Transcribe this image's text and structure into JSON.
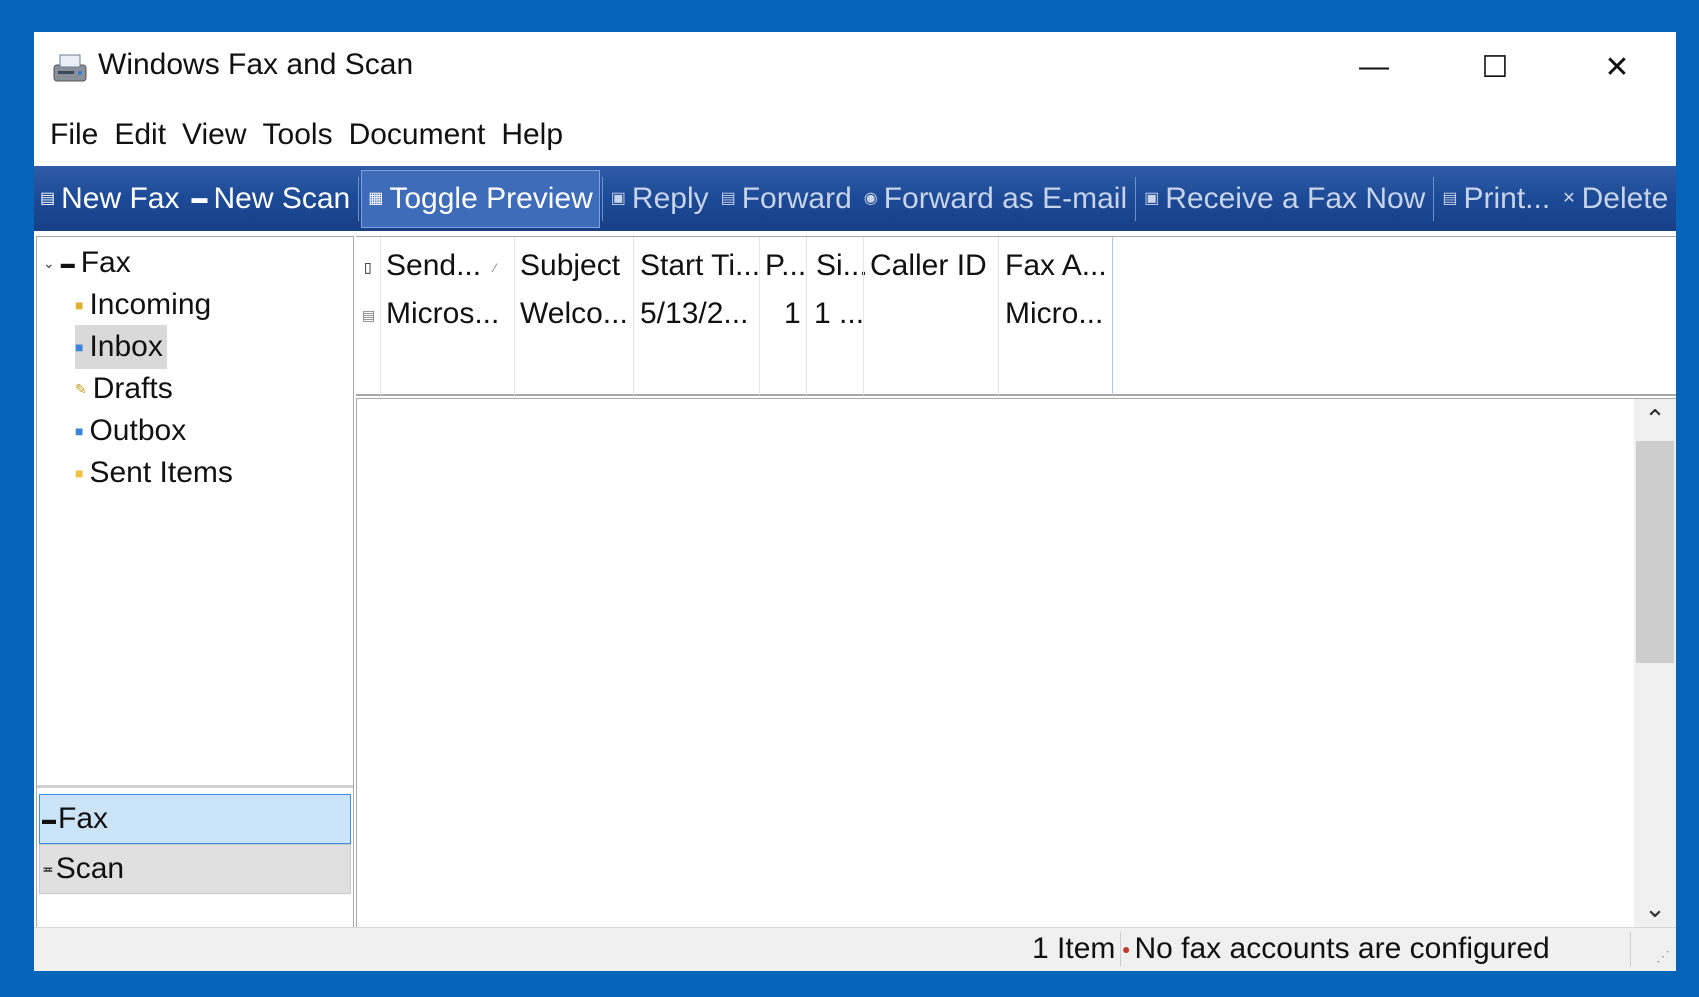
{
  "window": {
    "title": "Windows Fax and Scan",
    "controls": {
      "minimize": "—",
      "maximize": "☐",
      "close": "✕"
    }
  },
  "menu": [
    "File",
    "Edit",
    "View",
    "Tools",
    "Document",
    "Help"
  ],
  "toolbar": {
    "new_fax": "New Fax",
    "new_scan": "New Scan",
    "toggle_preview": "Toggle Preview",
    "reply": "Reply",
    "forward": "Forward",
    "forward_email": "Forward as E-mail",
    "receive_fax": "Receive a Fax Now",
    "print": "Print...",
    "delete": "Delete"
  },
  "tree": {
    "root": "Fax",
    "folders": [
      "Incoming",
      "Inbox",
      "Drafts",
      "Outbox",
      "Sent Items"
    ],
    "selected": "Inbox"
  },
  "nav": {
    "fax": "Fax",
    "scan": "Scan",
    "active": "Fax"
  },
  "list": {
    "columns": [
      "Send...",
      "Subject",
      "Start Ti...",
      "P...",
      "Si...",
      "Caller ID",
      "Fax A..."
    ],
    "rows": [
      [
        "Micros...",
        "Welco...",
        "5/13/2...",
        "1",
        "1 ...",
        "",
        "Micro..."
      ]
    ]
  },
  "status": {
    "count": "1 Item",
    "message": "No fax accounts are configured"
  },
  "colors": {
    "accent": "#0563b8",
    "toolbar": "#1d4a96",
    "selected_nav": "#cce4f7"
  },
  "icons": [
    "fax-scanner-icon",
    "new-fax-icon",
    "new-scan-icon",
    "preview-icon",
    "reply-icon",
    "forward-icon",
    "email-icon",
    "receive-fax-icon",
    "print-icon",
    "delete-icon",
    "folder-icon",
    "error-icon"
  ]
}
